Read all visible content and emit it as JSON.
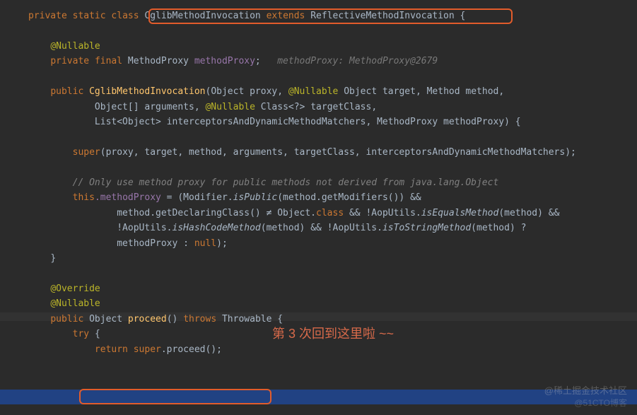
{
  "code": {
    "l1_private": "private",
    "l1_static": "static",
    "l1_class": "class",
    "l1_name": "CglibMethodInvocation",
    "l1_extends": "extends",
    "l1_parent": "ReflectiveMethodInvocation",
    "l1_brace": "{",
    "l3_ann": "@Nullable",
    "l4_private": "private",
    "l4_final": "final",
    "l4_type": "MethodProxy",
    "l4_field": "methodProxy",
    "l4_hint": "methodProxy: MethodProxy@2679",
    "l6_public": "public",
    "l6_ctor": "CglibMethodInvocation",
    "l6_p1t": "Object",
    "l6_p1n": "proxy",
    "l6_ann": "@Nullable",
    "l6_p2t": "Object",
    "l6_p2n": "target",
    "l6_p3t": "Method",
    "l6_p3n": "method",
    "l7_p4t": "Object[]",
    "l7_p4n": "arguments",
    "l7_ann": "@Nullable",
    "l7_p5t": "Class<?>",
    "l7_p5n": "targetClass",
    "l8_p6t": "List<Object>",
    "l8_p6n": "interceptorsAndDynamicMethodMatchers",
    "l8_p7t": "MethodProxy",
    "l8_p7n": "methodProxy",
    "l8_brace": "{",
    "l10_super": "super",
    "l10_args": "(proxy, target, method, arguments, targetClass, interceptorsAndDynamicMethodMatchers);",
    "l12_comment": "// Only use method proxy for public methods not derived from java.lang.Object",
    "l13_this": "this",
    "l13_field": ".methodProxy",
    "l13_eq": " = (Modifier.",
    "l13_m1": "isPublic",
    "l13_rest": "(method.getModifiers()) &&",
    "l14_a": "method.getDeclaringClass() ",
    "l14_ne": "≠",
    "l14_b": " Object.",
    "l14_class": "class",
    "l14_c": " && !AopUtils.",
    "l14_m": "isEqualsMethod",
    "l14_d": "(method) &&",
    "l15_a": "!AopUtils.",
    "l15_m1": "isHashCodeMethod",
    "l15_b": "(method) && !AopUtils.",
    "l15_m2": "isToStringMethod",
    "l15_c": "(method) ?",
    "l16_a": "methodProxy : ",
    "l16_null": "null",
    "l16_b": ");",
    "l17_brace": "}",
    "l19_override": "@Override",
    "l20_nullable": "@Nullable",
    "l21_public": "public",
    "l21_ret": "Object",
    "l21_name": "proceed",
    "l21_throws": "throws",
    "l21_exc": "Throwable",
    "l21_brace": "{",
    "l22_try": "try",
    "l22_brace": "{",
    "l23_return": "return",
    "l23_super": "super",
    "l23_call": ".proceed();"
  },
  "annotation": "第 3 次回到这里啦 ~~",
  "watermarks": {
    "w1": "@稀土掘金技术社区",
    "w2": "@51CTO博客"
  }
}
